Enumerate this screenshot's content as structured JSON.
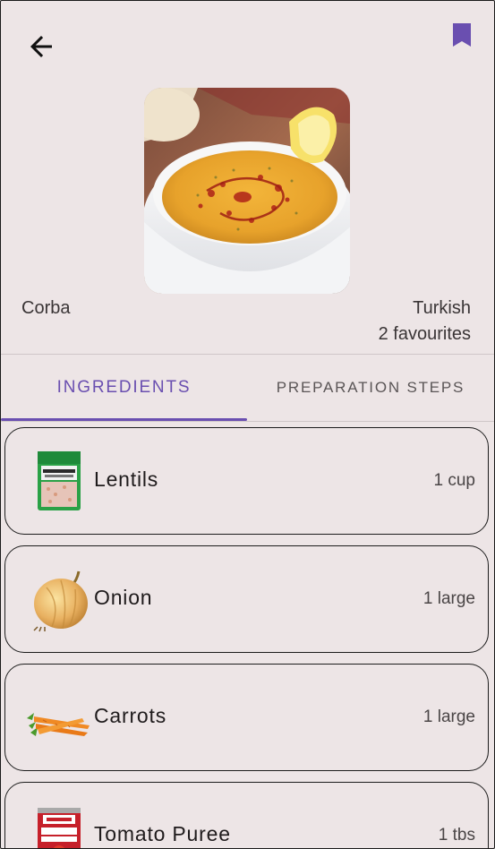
{
  "colors": {
    "background": "#ede5e6",
    "accent": "#6a4fb0",
    "text": "#1f1b1c",
    "muted": "#5a5556"
  },
  "header": {
    "back_icon": "arrow-left-icon",
    "bookmark_icon": "bookmark-icon"
  },
  "recipe": {
    "name": "Corba",
    "cuisine": "Turkish",
    "favourites": "2 favourites"
  },
  "tabs": [
    {
      "label": "INGREDIENTS",
      "selected": true
    },
    {
      "label": "PREPARATION STEPS",
      "selected": false
    }
  ],
  "ingredients": [
    {
      "name": "Lentils",
      "quantity": "1 cup",
      "icon": "lentils-bag-icon"
    },
    {
      "name": "Onion",
      "quantity": "1 large",
      "icon": "onion-icon"
    },
    {
      "name": "Carrots",
      "quantity": "1 large",
      "icon": "carrots-icon"
    },
    {
      "name": "Tomato Puree",
      "quantity": "1 tbs",
      "icon": "tomato-puree-can-icon"
    }
  ]
}
